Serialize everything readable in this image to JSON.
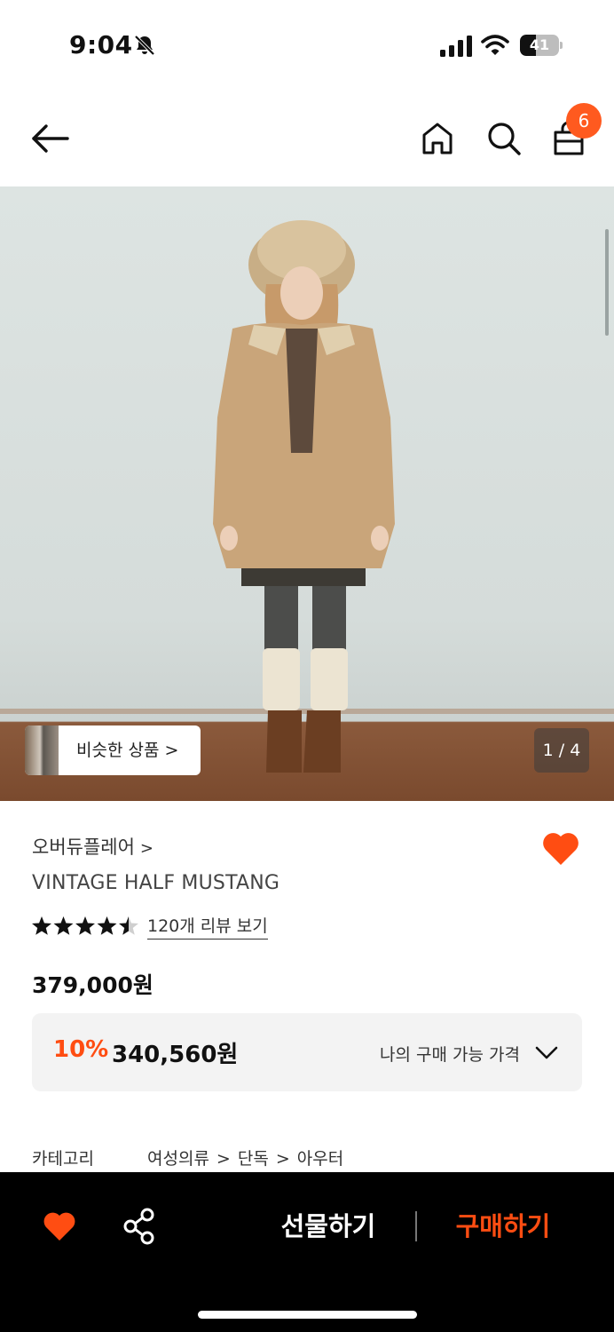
{
  "status_bar": {
    "time": "9:04",
    "battery": "41",
    "battery_level": 0.41,
    "icons": [
      "bell-slash-icon",
      "cellular-signal-icon",
      "wifi-icon",
      "battery-icon"
    ]
  },
  "header": {
    "icons": [
      "arrow-left-icon",
      "home-icon",
      "search-icon",
      "shopping-bag-icon"
    ],
    "cart_count": "6"
  },
  "gallery": {
    "similar_label": "비슷한 상품 >",
    "counter": "1 / 4"
  },
  "product": {
    "brand": "오버듀플레어",
    "brand_chevron": ">",
    "name": "VINTAGE HALF MUSTANG",
    "rating": 4.5,
    "review_link": "120개 리뷰 보기",
    "price": "379,000원",
    "discount_rate": "10%",
    "discount_price": "340,560원",
    "my_price_label": "나의 구매 가능 가격"
  },
  "category": {
    "label": "카테고리",
    "path": [
      "여성의류",
      "단독",
      "아우터"
    ],
    "separator": ">"
  },
  "bottom_bar": {
    "gift_label": "선물하기",
    "buy_label": "구매하기"
  },
  "colors": {
    "accent": "#ff4d12",
    "badge": "#ff5a1f",
    "bottom_bar_bg": "#000000"
  }
}
